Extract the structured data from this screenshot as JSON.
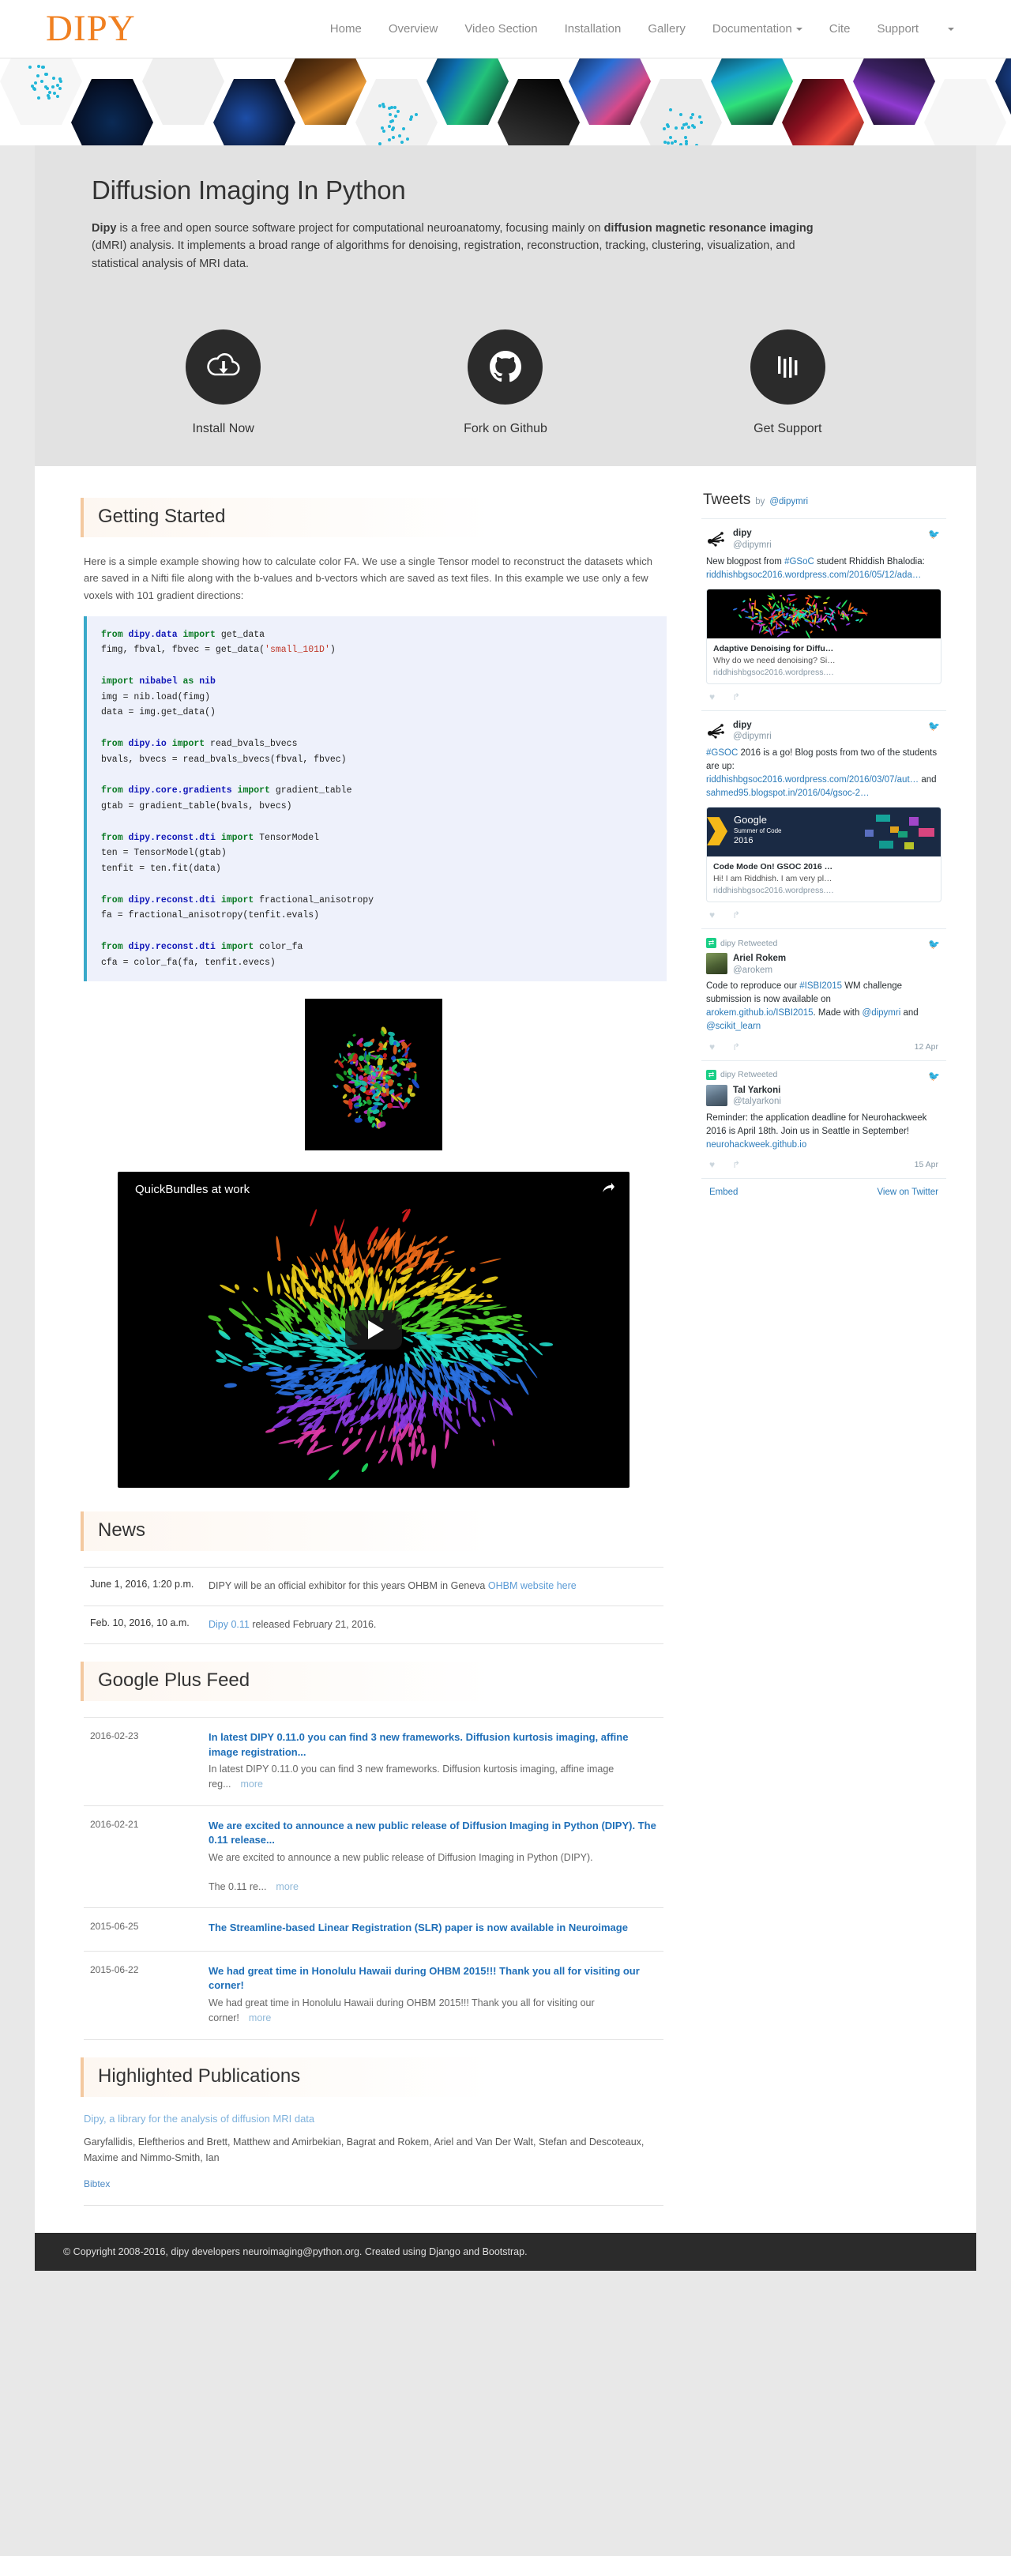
{
  "navbar": {
    "brand": "DIPY",
    "items": [
      {
        "label": "Home",
        "caret": false
      },
      {
        "label": "Overview",
        "caret": false
      },
      {
        "label": "Video Section",
        "caret": false
      },
      {
        "label": "Installation",
        "caret": false
      },
      {
        "label": "Gallery",
        "caret": false
      },
      {
        "label": "Documentation",
        "caret": true
      },
      {
        "label": "Cite",
        "caret": false
      },
      {
        "label": "Support",
        "caret": false
      }
    ]
  },
  "hero": {
    "title": "Diffusion Imaging In Python",
    "lead_strong_1": "Dipy",
    "lead_text_1": " is a free and open source software project for computational neuroanatomy, focusing mainly on ",
    "lead_strong_2": "diffusion magnetic resonance imaging",
    "lead_text_2": " (dMRI) analysis. It implements a broad range of algorithms for denoising, registration, reconstruction, tracking, clustering, visualization, and statistical analysis of MRI data.",
    "actions": [
      {
        "label": "Install Now",
        "icon": "cloud-download-icon"
      },
      {
        "label": "Fork on Github",
        "icon": "github-icon"
      },
      {
        "label": "Get Support",
        "icon": "bars-icon"
      }
    ]
  },
  "getting_started": {
    "heading": "Getting Started",
    "intro": "Here is a simple example showing how to calculate color FA. We use a single Tensor model to reconstruct the datasets which are saved in a Nifti file along with the b-values and b-vectors which are saved as text files. In this example we use only a few voxels with 101 gradient directions:",
    "code_lines": [
      {
        "parts": [
          {
            "t": "from ",
            "c": "k"
          },
          {
            "t": "dipy.data ",
            "c": "m"
          },
          {
            "t": "import ",
            "c": "k"
          },
          {
            "t": "get_data",
            "c": ""
          }
        ]
      },
      {
        "parts": [
          {
            "t": "fimg, fbval, fbvec = get_data(",
            "c": ""
          },
          {
            "t": "'small_101D'",
            "c": "s"
          },
          {
            "t": ")",
            "c": ""
          }
        ]
      },
      {
        "parts": [
          {
            "t": "",
            "c": ""
          }
        ]
      },
      {
        "parts": [
          {
            "t": "import ",
            "c": "k"
          },
          {
            "t": "nibabel ",
            "c": "m"
          },
          {
            "t": "as ",
            "c": "k"
          },
          {
            "t": "nib",
            "c": "m"
          }
        ]
      },
      {
        "parts": [
          {
            "t": "img = nib.load(fimg)",
            "c": ""
          }
        ]
      },
      {
        "parts": [
          {
            "t": "data = img.get_data()",
            "c": ""
          }
        ]
      },
      {
        "parts": [
          {
            "t": "",
            "c": ""
          }
        ]
      },
      {
        "parts": [
          {
            "t": "from ",
            "c": "k"
          },
          {
            "t": "dipy.io ",
            "c": "m"
          },
          {
            "t": "import ",
            "c": "k"
          },
          {
            "t": "read_bvals_bvecs",
            "c": ""
          }
        ]
      },
      {
        "parts": [
          {
            "t": "bvals, bvecs = read_bvals_bvecs(fbval, fbvec)",
            "c": ""
          }
        ]
      },
      {
        "parts": [
          {
            "t": "",
            "c": ""
          }
        ]
      },
      {
        "parts": [
          {
            "t": "from ",
            "c": "k"
          },
          {
            "t": "dipy.core.gradients ",
            "c": "m"
          },
          {
            "t": "import ",
            "c": "k"
          },
          {
            "t": "gradient_table",
            "c": ""
          }
        ]
      },
      {
        "parts": [
          {
            "t": "gtab = gradient_table(bvals, bvecs)",
            "c": ""
          }
        ]
      },
      {
        "parts": [
          {
            "t": "",
            "c": ""
          }
        ]
      },
      {
        "parts": [
          {
            "t": "from ",
            "c": "k"
          },
          {
            "t": "dipy.reconst.dti ",
            "c": "m"
          },
          {
            "t": "import ",
            "c": "k"
          },
          {
            "t": "TensorModel",
            "c": ""
          }
        ]
      },
      {
        "parts": [
          {
            "t": "ten = TensorModel(gtab)",
            "c": ""
          }
        ]
      },
      {
        "parts": [
          {
            "t": "tenfit = ten.fit(data)",
            "c": ""
          }
        ]
      },
      {
        "parts": [
          {
            "t": "",
            "c": ""
          }
        ]
      },
      {
        "parts": [
          {
            "t": "from ",
            "c": "k"
          },
          {
            "t": "dipy.reconst.dti ",
            "c": "m"
          },
          {
            "t": "import ",
            "c": "k"
          },
          {
            "t": "fractional_anisotropy",
            "c": ""
          }
        ]
      },
      {
        "parts": [
          {
            "t": "fa = fractional_anisotropy(tenfit.evals)",
            "c": ""
          }
        ]
      },
      {
        "parts": [
          {
            "t": "",
            "c": ""
          }
        ]
      },
      {
        "parts": [
          {
            "t": "from ",
            "c": "k"
          },
          {
            "t": "dipy.reconst.dti ",
            "c": "m"
          },
          {
            "t": "import ",
            "c": "k"
          },
          {
            "t": "color_fa",
            "c": ""
          }
        ]
      },
      {
        "parts": [
          {
            "t": "cfa = color_fa(fa, tenfit.evecs)",
            "c": ""
          }
        ]
      }
    ],
    "video_title": "QuickBundles at work"
  },
  "news": {
    "heading": "News",
    "items": [
      {
        "date": "June 1, 2016, 1:20 p.m.",
        "text": "DIPY will be an official exhibitor for this years OHBM in Geneva ",
        "link": "OHBM website here",
        "text_after": "",
        "link_first": false
      },
      {
        "date": "Feb. 10, 2016, 10 a.m.",
        "text": "",
        "link": "Dipy 0.11",
        "text_after": " released February 21, 2016.",
        "link_first": true
      }
    ]
  },
  "gplus": {
    "heading": "Google Plus Feed",
    "more_label": "more",
    "items": [
      {
        "date": "2016-02-23",
        "title": "In latest DIPY 0.11.0 you can find 3 new frameworks. Diffusion kurtosis imaging, affine image registration...",
        "snippet": "In latest DIPY 0.11.0 you can find 3 new frameworks. Diffusion kurtosis imaging, affine image reg...",
        "has_more": true
      },
      {
        "date": "2016-02-21",
        "title": "We are excited to announce a new public release of Diffusion Imaging in Python (DIPY). The 0.11 release...",
        "snippet": "We are excited to announce a new public release of Diffusion Imaging in Python (DIPY).",
        "snippet2": "The 0.11 re...",
        "has_more": true
      },
      {
        "date": "2015-06-25",
        "title": "The Streamline-based Linear Registration (SLR) paper is now available in Neuroimage",
        "snippet": "",
        "has_more": false
      },
      {
        "date": "2015-06-22",
        "title": "We had great time in Honolulu Hawaii during OHBM 2015!!! Thank you all for visiting our corner!",
        "snippet": "We had great time in Honolulu Hawaii during OHBM 2015!!! Thank you all for visiting our corner!",
        "has_more": true
      }
    ]
  },
  "publications": {
    "heading": "Highlighted Publications",
    "items": [
      {
        "title": "Dipy, a library for the analysis of diffusion MRI data",
        "authors": "Garyfallidis, Eleftherios and Brett, Matthew and Amirbekian, Bagrat and Rokem, Ariel and Van Der Walt, Stefan and Descoteaux, Maxime and Nimmo-Smith, Ian",
        "bibtex": "Bibtex"
      }
    ]
  },
  "twitter": {
    "header_title": "Tweets",
    "header_by": "by",
    "header_handle": "@dipymri",
    "footer_embed": "Embed",
    "footer_view": "View on Twitter",
    "tweets": [
      {
        "retweet_label": "",
        "name": "dipy",
        "handle": "@dipymri",
        "avatar": "dipy",
        "text_parts": [
          {
            "t": "New blogpost from ",
            "link": false
          },
          {
            "t": "#GSoC",
            "link": true
          },
          {
            "t": " student Rhiddish Bhalodia: ",
            "link": false
          },
          {
            "t": "riddhishbgsoc2016.wordpress.com/2016/05/12/ada…",
            "link": true
          }
        ],
        "card": {
          "kind": "tractography",
          "title": "Adaptive Denoising for Diffu…",
          "desc": "Why do we need denoising? Si…",
          "domain": "riddhishbgsoc2016.wordpress.…"
        },
        "date": ""
      },
      {
        "retweet_label": "",
        "name": "dipy",
        "handle": "@dipymri",
        "avatar": "dipy",
        "text_parts": [
          {
            "t": "#GSOC",
            "link": true
          },
          {
            "t": " 2016 is a go! Blog posts from two of the students are up: ",
            "link": false
          },
          {
            "t": "riddhishbgsoc2016.wordpress.com/2016/03/07/aut…",
            "link": true
          },
          {
            "t": " and ",
            "link": false
          },
          {
            "t": "sahmed95.blogspot.in/2016/04/gsoc-2…",
            "link": true
          }
        ],
        "card": {
          "kind": "gsoc",
          "title": "Code Mode On! GSOC 2016 …",
          "desc": "Hi! I am Riddhish. I am very pl…",
          "domain": "riddhishbgsoc2016.wordpress.…",
          "logo_line1": "Google",
          "logo_line2": "Summer of Code",
          "logo_line3": "2016"
        },
        "date": ""
      },
      {
        "retweet_label": "dipy Retweeted",
        "name": "Ariel Rokem",
        "handle": "@arokem",
        "avatar": "ariel",
        "text_parts": [
          {
            "t": "Code to reproduce our ",
            "link": false
          },
          {
            "t": "#ISBI2015",
            "link": true
          },
          {
            "t": " WM challenge submission is now available on ",
            "link": false
          },
          {
            "t": "arokem.github.io/ISBI2015",
            "link": true
          },
          {
            "t": ". Made with ",
            "link": false
          },
          {
            "t": "@dipymri",
            "link": true
          },
          {
            "t": " and ",
            "link": false
          },
          {
            "t": "@scikit_learn",
            "link": true
          }
        ],
        "card": null,
        "date": "12 Apr"
      },
      {
        "retweet_label": "dipy Retweeted",
        "name": "Tal Yarkoni",
        "handle": "@talyarkoni",
        "avatar": "tal",
        "text_parts": [
          {
            "t": "Reminder: the application deadline for Neurohackweek 2016 is April 18th. Join us in Seattle in September! ",
            "link": false
          },
          {
            "t": "neurohackweek.github.io",
            "link": true
          }
        ],
        "card": null,
        "date": "15 Apr"
      }
    ]
  },
  "footer": {
    "copyright": "© Copyright 2008-2016, dipy developers neuroimaging@python.org. Created using Django and Bootstrap."
  }
}
